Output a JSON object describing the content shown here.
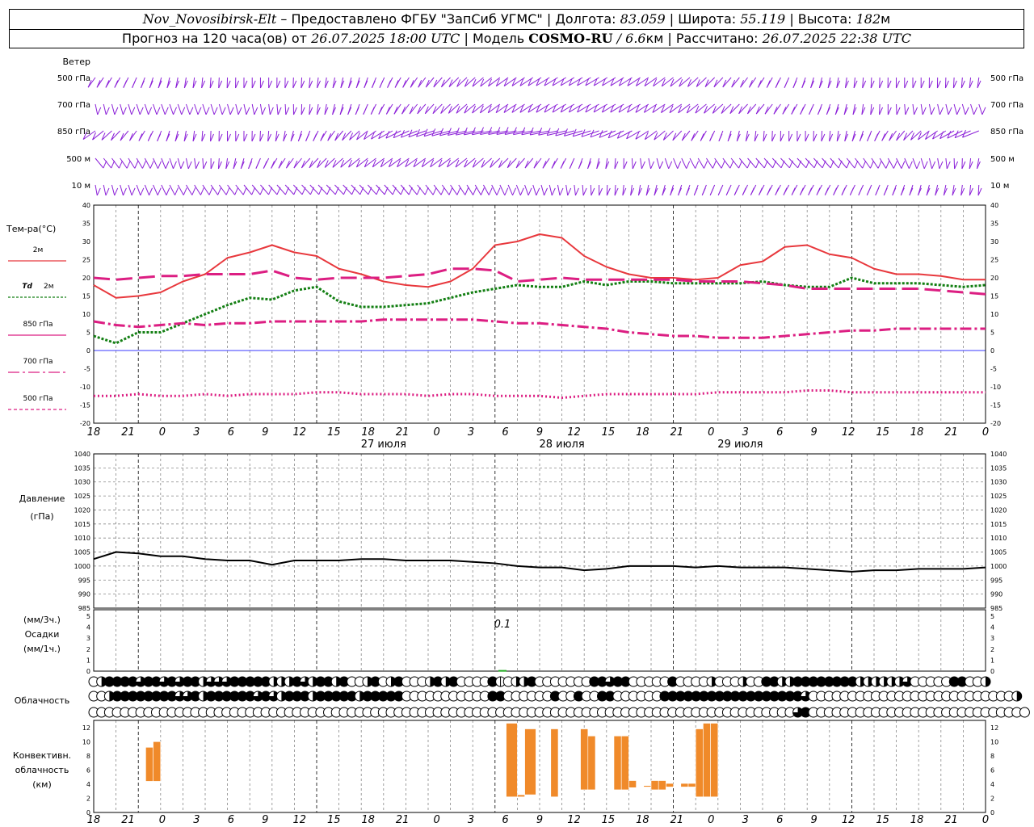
{
  "header": {
    "station": "Nov_Novosibirsk-Elt",
    "dash": "–",
    "provided": "Предоставлено ФГБУ \"ЗапСиб УГМС\"",
    "lon_label": "Долгота:",
    "lon_value": "83.059",
    "lat_label": "Широта:",
    "lat_value": "55.119",
    "alt_label": "Высота:",
    "alt_value": "182",
    "alt_unit": "м",
    "forecast_prefix": "Прогноз на 120 часа(ов) от",
    "forecast_time": "26.07.2025 18:00 UTC",
    "model_label": "| Модель",
    "model_name": "COSMO-RU",
    "model_res": "/ 6.6",
    "model_res_unit": "км",
    "calc_label": "| Рассчитано:",
    "calc_time": "26.07.2025 22:38 UTC"
  },
  "time_axis": {
    "hour_labels": [
      "18",
      "21",
      "0",
      "3",
      "6",
      "9",
      "12",
      "15",
      "18",
      "21",
      "0",
      "3",
      "6",
      "9",
      "12",
      "15",
      "18",
      "21",
      "0",
      "3",
      "6",
      "9",
      "12",
      "15",
      "18",
      "21",
      "0"
    ],
    "date_labels": [
      "27 июля",
      "28 июля",
      "29 июля"
    ]
  },
  "wind_panel": {
    "title": "Ветер",
    "levels": [
      "500 гПа",
      "700 гПа",
      "850 гПа",
      "500 м",
      "10 м"
    ],
    "colors": {
      "barb": "#8b20d8"
    }
  },
  "chart_data": [
    {
      "type": "line",
      "panel": "temperature",
      "title": "Тем-ра(°C)",
      "ylim": [
        -20,
        40
      ],
      "yticks": [
        "40",
        "35",
        "30",
        "25",
        "20",
        "15",
        "10",
        "5",
        "0",
        "-5",
        "-10",
        "-15",
        "-20"
      ],
      "x_hours": [
        0,
        3,
        6,
        9,
        12,
        15,
        18,
        21,
        24,
        27,
        30,
        33,
        36,
        39,
        42,
        45,
        48,
        51,
        54,
        57,
        60,
        63,
        66,
        69,
        72,
        75,
        78,
        81,
        84,
        87,
        90,
        93,
        96,
        99,
        102,
        105,
        108,
        111,
        114,
        117,
        120
      ],
      "series": [
        {
          "name": "2м",
          "style": "solid",
          "color": "#e8383d",
          "values": [
            18,
            14.5,
            15,
            16,
            19,
            21,
            25.5,
            27,
            29,
            27,
            26,
            22.5,
            21,
            19,
            18,
            17.5,
            19,
            22.5,
            29,
            30,
            32,
            31,
            26,
            23,
            21,
            20,
            20,
            19.5,
            20,
            23.5,
            24.5,
            28.5,
            29,
            26.5,
            25.5,
            22.5,
            21,
            21,
            20.5,
            19.5,
            19.5
          ]
        },
        {
          "name": "Td 2м",
          "style": "dotted",
          "color": "#137f13",
          "values": [
            4,
            2,
            5,
            5,
            7.5,
            10,
            12.5,
            14.5,
            14,
            16.5,
            17.5,
            13.5,
            12,
            12,
            12.5,
            13,
            14.5,
            16,
            17,
            18,
            17.5,
            17.5,
            19,
            18,
            19,
            19,
            18.5,
            18.5,
            18.5,
            18.5,
            19,
            18,
            17.5,
            17.5,
            20,
            18.5,
            18.5,
            18.5,
            18,
            17.5,
            18
          ]
        },
        {
          "name": "850 гПа",
          "style": "dashdot",
          "color": "#dc1e82",
          "values": [
            8,
            7,
            6.5,
            7,
            7.5,
            7,
            7.5,
            7.5,
            8,
            8,
            8,
            8,
            8,
            8.5,
            8.5,
            8.5,
            8.5,
            8.5,
            8,
            7.5,
            7.5,
            7,
            6.5,
            6,
            5,
            4.5,
            4,
            4,
            3.5,
            3.5,
            3.5,
            4,
            4.5,
            5,
            5.5,
            5.5,
            6,
            6,
            6,
            6,
            6
          ]
        },
        {
          "name": "700 гПа",
          "style": "longdash",
          "color": "#dc1e82",
          "values": [
            20,
            19.5,
            20,
            20.5,
            20.5,
            21,
            21,
            21,
            22,
            20,
            19.5,
            20,
            20,
            20,
            20.5,
            21,
            22.5,
            22.5,
            22,
            19,
            19.5,
            20,
            19.5,
            19.5,
            19.5,
            19.5,
            19.5,
            19,
            19,
            19,
            18.5,
            18,
            17,
            17,
            17,
            17,
            17,
            17,
            16.5,
            16,
            15.5
          ]
        },
        {
          "name": "500 гПа",
          "style": "fine-dotted",
          "color": "#dc1e82",
          "values": [
            -12.5,
            -12.5,
            -12,
            -12.5,
            -12.5,
            -12,
            -12.5,
            -12,
            -12,
            -12,
            -11.5,
            -11.5,
            -12,
            -12,
            -12,
            -12.5,
            -12,
            -12,
            -12.5,
            -12.5,
            -12.5,
            -13,
            -12.5,
            -12,
            -12,
            -12,
            -12,
            -12,
            -11.5,
            -11.5,
            -11.5,
            -11.5,
            -11,
            -11,
            -11.5,
            -11.5,
            -11.5,
            -11.5,
            -11.5,
            -11.5,
            -11.5
          ]
        }
      ]
    },
    {
      "type": "line",
      "panel": "pressure",
      "title": "Давление",
      "ylabel": "(гПа)",
      "ylim": [
        985,
        1040
      ],
      "yticks": [
        "1040",
        "1035",
        "1030",
        "1025",
        "1020",
        "1015",
        "1010",
        "1005",
        "1000",
        "995",
        "990",
        "985"
      ],
      "x_hours": [
        0,
        3,
        6,
        9,
        12,
        15,
        18,
        21,
        24,
        27,
        30,
        33,
        36,
        39,
        42,
        45,
        48,
        51,
        54,
        57,
        60,
        63,
        66,
        69,
        72,
        75,
        78,
        81,
        84,
        87,
        90,
        93,
        96,
        99,
        102,
        105,
        108,
        111,
        114,
        117,
        120
      ],
      "series": [
        {
          "name": "pressure",
          "style": "solid",
          "color": "#000000",
          "values": [
            1002.5,
            1005,
            1004.5,
            1003.5,
            1003.5,
            1002.5,
            1002,
            1002,
            1000.5,
            1002,
            1002,
            1002,
            1002.5,
            1002.5,
            1002,
            1002,
            1002,
            1001.5,
            1001,
            1000,
            999.5,
            999.5,
            998.5,
            999,
            1000,
            1000,
            1000,
            999.5,
            1000,
            999.5,
            999.5,
            999.5,
            999,
            998.5,
            998,
            998.5,
            998.5,
            999,
            999,
            999,
            999.5
          ]
        }
      ]
    },
    {
      "type": "bar",
      "panel": "precipitation",
      "title": "Осадки",
      "ylabel_top": "(мм/3ч.)",
      "ylabel_bottom": "(мм/1ч.)",
      "ylim": [
        0,
        5
      ],
      "yticks": [
        "5",
        "4",
        "3",
        "2",
        "1",
        "0"
      ],
      "bars": [
        {
          "hour": 55,
          "value": 0.1
        }
      ],
      "annotation": "0.1"
    },
    {
      "type": "bar",
      "panel": "convective",
      "title_lines": [
        "Конвективн.",
        "облачность",
        "(км)"
      ],
      "ylim": [
        0,
        13
      ],
      "yticks": [
        "12",
        "10",
        "8",
        "6",
        "4",
        "2",
        "0"
      ],
      "bars": [
        {
          "h0": 7,
          "h1": 8,
          "base": 4.4,
          "top": 9.2
        },
        {
          "h0": 8,
          "h1": 9,
          "base": 4.4,
          "top": 10
        },
        {
          "h0": 55.5,
          "h1": 57,
          "base": 2.2,
          "top": 12.6
        },
        {
          "h0": 57,
          "h1": 58,
          "base": 2.2,
          "top": 2.5
        },
        {
          "h0": 58,
          "h1": 59.5,
          "base": 2.5,
          "top": 11.8
        },
        {
          "h0": 61.5,
          "h1": 62.5,
          "base": 2.2,
          "top": 11.8
        },
        {
          "h0": 65.5,
          "h1": 66.5,
          "base": 3.2,
          "top": 11.8
        },
        {
          "h0": 66.5,
          "h1": 67.5,
          "base": 3.2,
          "top": 10.8
        },
        {
          "h0": 70,
          "h1": 71,
          "base": 3.2,
          "top": 10.8
        },
        {
          "h0": 71,
          "h1": 72,
          "base": 3.2,
          "top": 10.8
        },
        {
          "h0": 72,
          "h1": 73,
          "base": 3.5,
          "top": 4.5
        },
        {
          "h0": 74,
          "h1": 75,
          "base": 3.6,
          "top": 3.8
        },
        {
          "h0": 75,
          "h1": 76,
          "base": 3.2,
          "top": 4.5
        },
        {
          "h0": 76,
          "h1": 77,
          "base": 3.2,
          "top": 4.5
        },
        {
          "h0": 77,
          "h1": 78,
          "base": 3.6,
          "top": 4.1
        },
        {
          "h0": 79,
          "h1": 80,
          "base": 3.6,
          "top": 4.1
        },
        {
          "h0": 80,
          "h1": 81,
          "base": 3.6,
          "top": 4.1
        },
        {
          "h0": 81,
          "h1": 82,
          "base": 2.2,
          "top": 11.8
        },
        {
          "h0": 82,
          "h1": 83,
          "base": 2.2,
          "top": 12.6
        },
        {
          "h0": 83,
          "h1": 84,
          "base": 2.2,
          "top": 12.6
        }
      ],
      "color": "#f08a2a"
    },
    {
      "type": "table",
      "panel": "cloudiness",
      "title": "Облачность",
      "note": "cloud cover symbols, 0=clear,1=quarter,2=half,3=three-quarter,4=overcast",
      "rows": [
        [
          0,
          2,
          4,
          4,
          4,
          4,
          3,
          4,
          4,
          3,
          4,
          3,
          4,
          4,
          2,
          3,
          3,
          3,
          4,
          4,
          4,
          4,
          4,
          2,
          2,
          2,
          4,
          3,
          2,
          4,
          4,
          2,
          4,
          0,
          0,
          2,
          4,
          0,
          2,
          4,
          0,
          0,
          0,
          2,
          4,
          2,
          4,
          0,
          0,
          0,
          0,
          4,
          1,
          0,
          2,
          2,
          4,
          0,
          0,
          0,
          0,
          0,
          0,
          0,
          4,
          4,
          3,
          4,
          4,
          0,
          0,
          0,
          0,
          0,
          4,
          0,
          0,
          0,
          0,
          2,
          0,
          0,
          0,
          2,
          0,
          0,
          4,
          4,
          2,
          2,
          4,
          4,
          4,
          4,
          4,
          4,
          4,
          4,
          2,
          2,
          2,
          2,
          2,
          2,
          3,
          0,
          0,
          0,
          0,
          0,
          4,
          4,
          0,
          0,
          2
        ],
        [
          0,
          0,
          2,
          4,
          4,
          4,
          4,
          4,
          4,
          4,
          4,
          3,
          3,
          4,
          2,
          4,
          4,
          4,
          4,
          4,
          4,
          3,
          4,
          3,
          2,
          4,
          4,
          4,
          2,
          4,
          4,
          4,
          4,
          4,
          2,
          4,
          4,
          4,
          4,
          4,
          0,
          0,
          0,
          0,
          0,
          0,
          0,
          0,
          0,
          0,
          0,
          4,
          4,
          0,
          0,
          0,
          0,
          0,
          0,
          4,
          0,
          0,
          4,
          0,
          0,
          4,
          4,
          0,
          0,
          0,
          0,
          0,
          0,
          4,
          4,
          4,
          4,
          4,
          4,
          4,
          4,
          4,
          4,
          4,
          4,
          4,
          4,
          4,
          4,
          4,
          4,
          3,
          0,
          0,
          0,
          0,
          0,
          0,
          0,
          0,
          0,
          0,
          0,
          0,
          0,
          0,
          0,
          0,
          0,
          0,
          0,
          0,
          0,
          0,
          0,
          0,
          0,
          0,
          2
        ],
        [
          0,
          0,
          0,
          0,
          0,
          0,
          0,
          0,
          0,
          0,
          0,
          0,
          0,
          0,
          0,
          0,
          0,
          0,
          0,
          0,
          0,
          0,
          0,
          0,
          0,
          0,
          0,
          0,
          0,
          0,
          0,
          0,
          0,
          0,
          0,
          0,
          0,
          0,
          0,
          0,
          0,
          0,
          0,
          0,
          0,
          0,
          0,
          0,
          0,
          0,
          0,
          0,
          0,
          0,
          0,
          0,
          0,
          0,
          0,
          0,
          0,
          0,
          0,
          0,
          0,
          0,
          0,
          0,
          0,
          0,
          0,
          0,
          0,
          0,
          0,
          0,
          0,
          0,
          0,
          0,
          0,
          0,
          0,
          0,
          0,
          0,
          0,
          0,
          0,
          0,
          3,
          4,
          0,
          0,
          0,
          0,
          0,
          0,
          0,
          0,
          0,
          0,
          0,
          0,
          0,
          0,
          0,
          0,
          0,
          0,
          0,
          0,
          0,
          0,
          0,
          0,
          0,
          0,
          0,
          0
        ]
      ]
    }
  ],
  "legend": {
    "t2m": "2м",
    "td_prefix": "Td",
    "td_suffix": "2м",
    "t850": "850 гПа",
    "t700": "700 гПа",
    "t500": "500 гПа"
  },
  "colors": {
    "grid": "#888888",
    "zero_line": "#3a3aff",
    "conv": "#f08a2a"
  }
}
